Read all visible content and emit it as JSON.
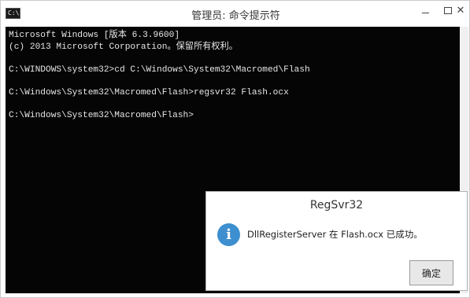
{
  "window": {
    "title": "管理员: 命令提示符",
    "icon_text": "C:\\"
  },
  "console": {
    "lines": [
      "Microsoft Windows [版本 6.3.9600]",
      "(c) 2013 Microsoft Corporation。保留所有权利。",
      "",
      "C:\\WINDOWS\\system32>cd C:\\Windows\\System32\\Macromed\\Flash",
      "",
      "C:\\Windows\\System32\\Macromed\\Flash>regsvr32 Flash.ocx",
      "",
      "C:\\Windows\\System32\\Macromed\\Flash>"
    ]
  },
  "dialog": {
    "title": "RegSvr32",
    "message": "DllRegisterServer 在 Flash.ocx 已成功。",
    "icon": "info-icon",
    "ok_label": "确定"
  },
  "colors": {
    "console_bg": "#050505",
    "console_text": "#e6e6e6",
    "info_icon": "#3d8fcf"
  }
}
